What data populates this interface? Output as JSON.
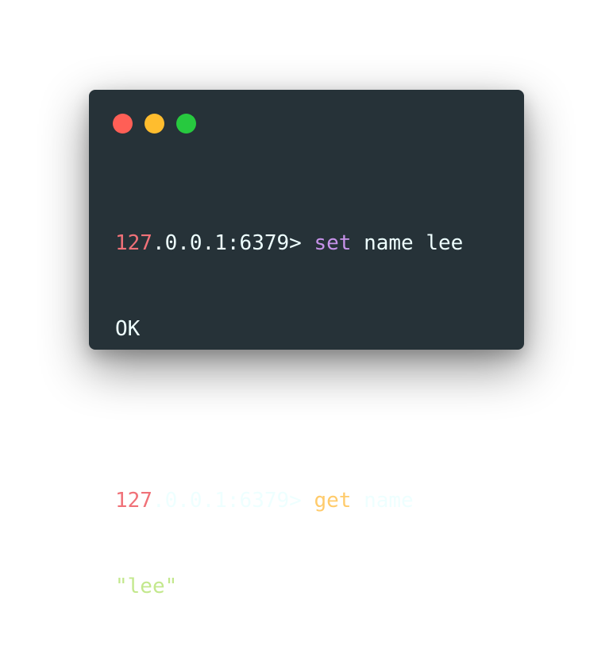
{
  "window": {
    "buttons": [
      {
        "name": "close",
        "color": "#ff5f56"
      },
      {
        "name": "minimize",
        "color": "#ffbd2e"
      },
      {
        "name": "maximize",
        "color": "#27c93f"
      }
    ],
    "background": "#263238"
  },
  "terminal": {
    "line1": {
      "prompt_num": "127",
      "prompt_rest": ".0.0.1:6379>",
      "command": "set",
      "args": "name lee"
    },
    "line2": {
      "output": "OK"
    },
    "line3": {
      "prompt_num": "127",
      "prompt_rest": ".0.0.1:6379>",
      "command": "get",
      "args": "name"
    },
    "line4": {
      "output": "\"lee\""
    }
  },
  "colors": {
    "number": "#f07178",
    "text": "#eeffff",
    "set_command": "#c792ea",
    "get_command": "#ffcb6b",
    "string": "#c3e88d"
  }
}
